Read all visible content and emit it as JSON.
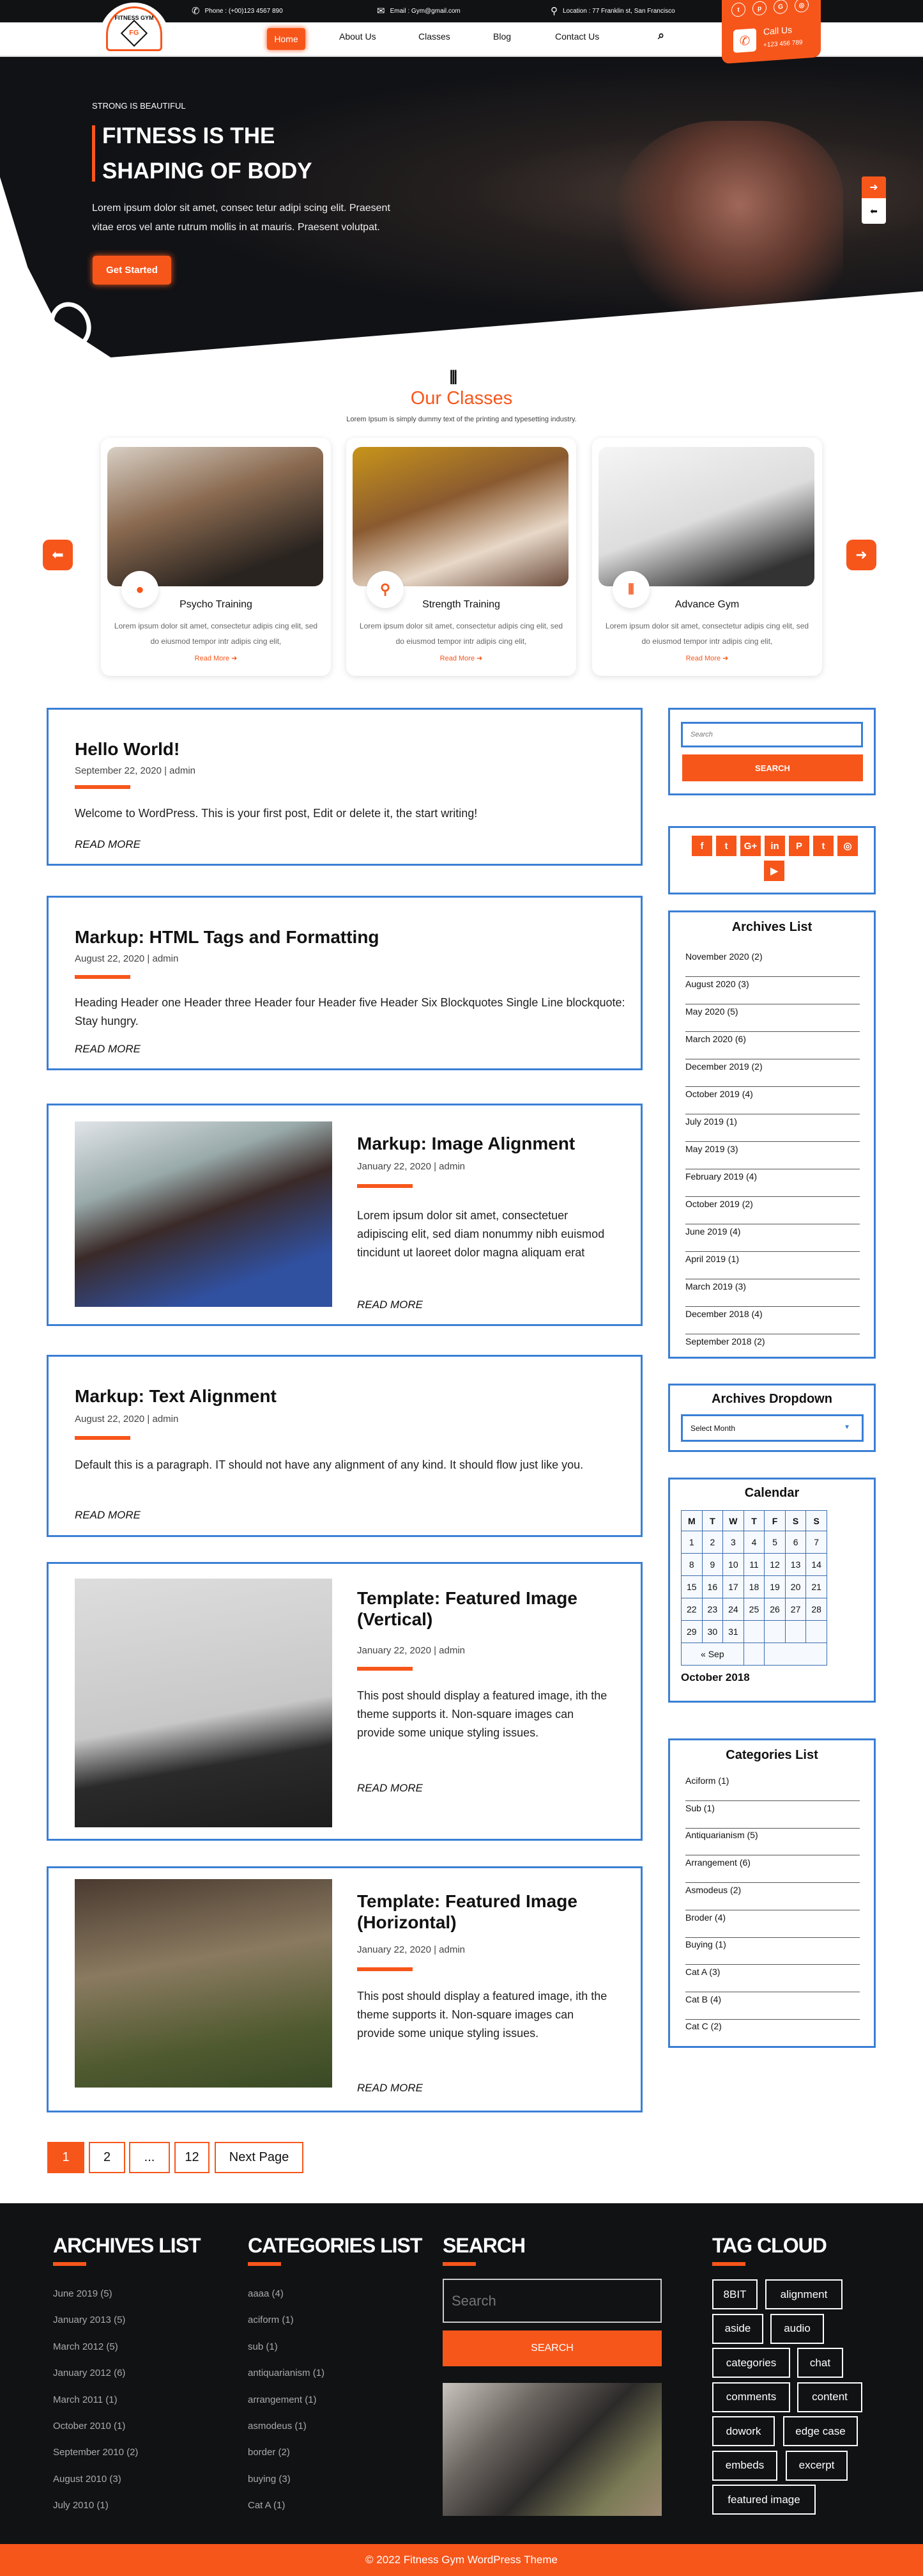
{
  "colors": {
    "accent": "#f7561b",
    "dark": "#111214",
    "widget_border": "#3a7fd5"
  },
  "topbar": {
    "phone": "Phone : (+00)123 4567 890",
    "email": "Email : Gym@gmail.com",
    "location": "Location : 77 Franklin st, San Francisco",
    "social_icons": [
      "twitter-icon",
      "pinterest-icon",
      "google-icon",
      "instagram-icon"
    ]
  },
  "logo": {
    "text": "FITNESS GYM",
    "mark": "FG"
  },
  "nav": {
    "items": [
      "Home",
      "About Us",
      "Classes",
      "Blog",
      "Contact Us"
    ],
    "active": "Home",
    "search_icon": "search-icon"
  },
  "call": {
    "label": "Call Us",
    "number": "+123 456 789"
  },
  "hero": {
    "kicker": "STRONG IS BEAUTIFUL",
    "title_line1": "FITNESS IS THE",
    "title_line2": "SHAPING OF BODY",
    "text_line1": "Lorem ipsum dolor sit amet, consec tetur adipi scing elit. Praesent",
    "text_line2": "vitae eros vel ante rutrum mollis in at mauris. Praesent volutpat.",
    "button": "Get Started"
  },
  "classes": {
    "title": "Our Classes",
    "subtitle": "Lorem Ipsum is simply dummy text of the printing and typesetting industry.",
    "cards": [
      {
        "title": "Psycho Training",
        "icon": "kettlebell-icon",
        "desc": "Lorem ipsum dolor sit amet, consectetur adipis cing elit, sed do eiusmod tempor intr adipis cing elit,",
        "link": "Read More"
      },
      {
        "title": "Strength Training",
        "icon": "bicycle-icon",
        "desc": "Lorem ipsum dolor sit amet, consectetur adipis cing elit, sed do eiusmod tempor intr adipis cing elit,",
        "link": "Read More"
      },
      {
        "title": "Advance Gym",
        "icon": "dumbbell-icon",
        "desc": "Lorem ipsum dolor sit amet, consectetur adipis cing elit, sed do eiusmod tempor intr adipis cing elit,",
        "link": "Read More"
      }
    ]
  },
  "posts": [
    {
      "title": "Hello World!",
      "meta": "September 22, 2020 | admin",
      "excerpt": "Welcome to WordPress. This is your first post, Edit or delete it, the start writing!",
      "read_more": "READ MORE"
    },
    {
      "title": "Markup: HTML Tags and Formatting",
      "meta": "August 22, 2020 | admin",
      "excerpt": "Heading Header one Header three Header four Header five Header Six Blockquotes Single Line blockquote: Stay hungry.",
      "read_more": "READ MORE"
    },
    {
      "title": "Markup: Image Alignment",
      "meta": "January 22, 2020 | admin",
      "excerpt": "Lorem ipsum dolor sit amet, consectetuer adipiscing elit, sed diam nonummy nibh euismod tincidunt ut laoreet dolor magna aliquam erat",
      "read_more": "READ MORE"
    },
    {
      "title": "Markup: Text Alignment",
      "meta": "August 22, 2020 | admin",
      "excerpt": "Default this is a paragraph. IT should not have any alignment of any kind. It should flow just like you.",
      "read_more": "READ MORE"
    },
    {
      "title": "Template: Featured Image (Vertical)",
      "meta": "January 22, 2020 | admin",
      "excerpt": "This post should display a featured image, ith the theme supports it. Non-square images can provide some unique styling issues.",
      "read_more": "READ MORE"
    },
    {
      "title": "Template: Featured Image (Horizontal)",
      "meta": "January 22, 2020 | admin",
      "excerpt": "This post should display a featured image, ith the theme supports it. Non-square images can provide some unique styling issues.",
      "read_more": "READ MORE"
    }
  ],
  "pagination": {
    "pages": [
      "1",
      "2",
      "...",
      "12"
    ],
    "current": "1",
    "next": "Next Page"
  },
  "sidebar": {
    "search": {
      "placeholder": "Search",
      "button": "SEARCH"
    },
    "social_icons": [
      "facebook-icon",
      "twitter-icon",
      "google-plus-icon",
      "linkedin-icon",
      "pinterest-icon",
      "tumblr-icon",
      "instagram-icon",
      "youtube-icon"
    ],
    "archives": {
      "title": "Archives List",
      "items": [
        "November 2020 (2)",
        "August 2020 (3)",
        "May 2020 (5)",
        "March 2020 (6)",
        "December 2019 (2)",
        "October 2019 (4)",
        "July 2019 (1)",
        "May 2019 (3)",
        "February 2019 (4)",
        "October 2019 (2)",
        "June 2019 (4)",
        "April 2019 (1)",
        "March 2019 (3)",
        "December 2018 (4)",
        "September 2018 (2)"
      ]
    },
    "dropdown": {
      "title": "Archives Dropdown",
      "selected": "Select Month"
    },
    "calendar": {
      "title": "Calendar",
      "days": [
        "M",
        "T",
        "W",
        "T",
        "F",
        "S",
        "S"
      ],
      "weeks": [
        [
          "1",
          "2",
          "3",
          "4",
          "5",
          "6",
          "7"
        ],
        [
          "8",
          "9",
          "10",
          "11",
          "12",
          "13",
          "14"
        ],
        [
          "15",
          "16",
          "17",
          "18",
          "19",
          "20",
          "21"
        ],
        [
          "22",
          "23",
          "24",
          "25",
          "26",
          "27",
          "28"
        ],
        [
          "29",
          "30",
          "31",
          "",
          "",
          "",
          ""
        ]
      ],
      "prev": "« Sep",
      "caption": "October 2018"
    },
    "categories": {
      "title": "Categories List",
      "items": [
        "Aciform (1)",
        "Sub (1)",
        "Antiquarianism (5)",
        "Arrangement (6)",
        "Asmodeus (2)",
        "Broder (4)",
        "Buying (1)",
        "Cat A (3)",
        "Cat B (4)",
        "Cat C (2)"
      ]
    }
  },
  "footer": {
    "archives": {
      "title": "ARCHIVES LIST",
      "items": [
        "June 2019 (5)",
        "January  2013 (5)",
        "March 2012 (5)",
        "January  2012 (6)",
        "March  2011 (1)",
        "October 2010 (1)",
        "September 2010 (2)",
        "August 2010 (3)",
        "July 2010 (1)"
      ]
    },
    "categories": {
      "title": "CATEGORIES LIST",
      "items": [
        "aaaa (4)",
        "aciform (1)",
        "sub (1)",
        "antiquarianism (1)",
        "arrangement (1)",
        "asmodeus (1)",
        "border (2)",
        "buying (3)",
        "Cat A (1)"
      ]
    },
    "search": {
      "title": "SEARCH",
      "placeholder": "Search",
      "button": "SEARCH"
    },
    "tags": {
      "title": "TAG CLOUD",
      "items": [
        "8BIT",
        "alignment",
        "aside",
        "audio",
        "categories",
        "chat",
        "comments",
        "content",
        "dowork",
        "edge case",
        "embeds",
        "excerpt",
        "featured image"
      ]
    },
    "copyright": "© 2022 Fitness Gym WordPress Theme"
  }
}
